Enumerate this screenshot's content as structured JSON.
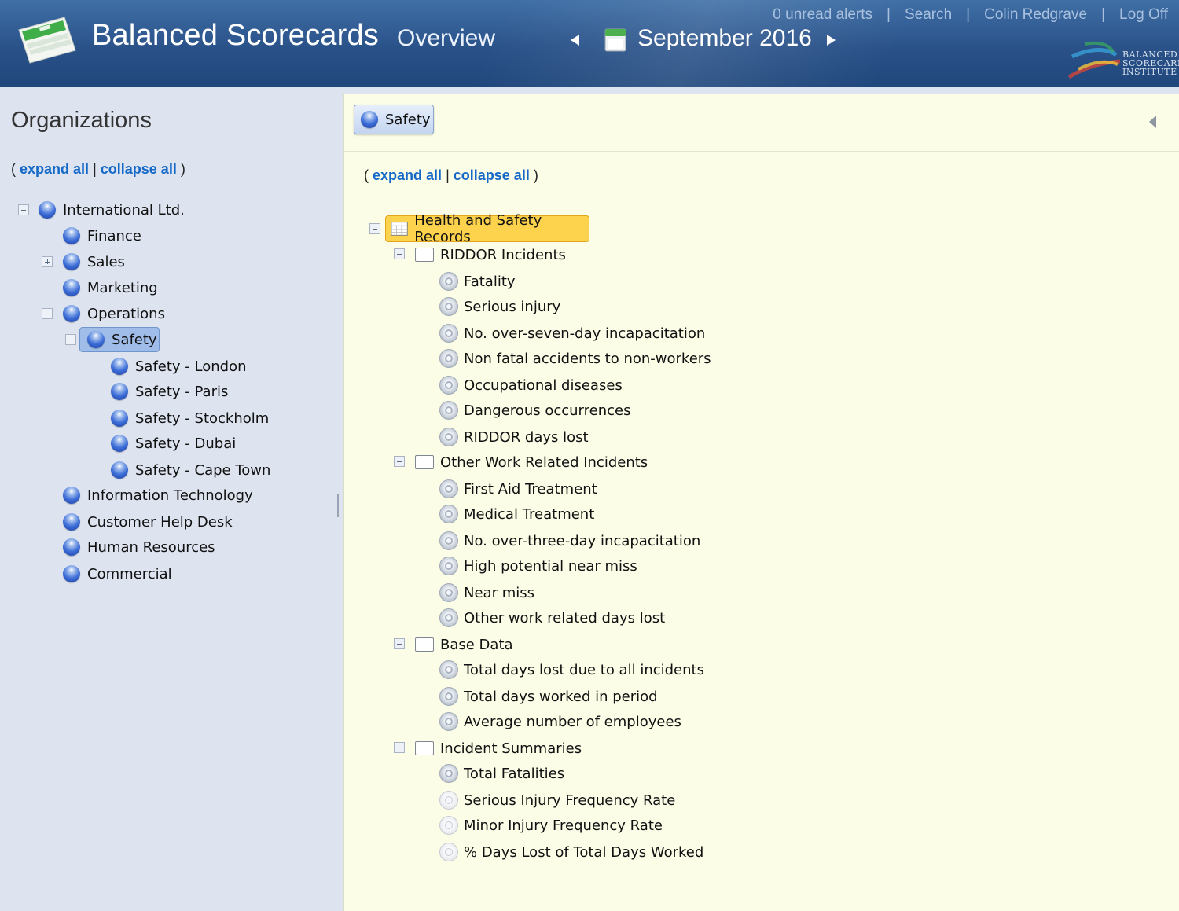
{
  "header": {
    "app_title": "Balanced Scorecards",
    "view_title": "Overview",
    "period": "September 2016",
    "links": {
      "alerts": "0 unread alerts",
      "search": "Search",
      "user": "Colin Redgrave",
      "logoff": "Log Off"
    },
    "separator": "|",
    "institute_lines": [
      "BALANCED",
      "SCORECARD",
      "INSTITUTE"
    ],
    "colors": {
      "header_top": "#3f6fa6",
      "header_bottom": "#1f477c"
    }
  },
  "left_panel": {
    "heading": "Organizations",
    "expand_all": "expand all",
    "collapse_all": "collapse all",
    "paren_open": "(",
    "paren_close": ")",
    "pipe": "|",
    "tree": [
      "International Ltd.",
      "Finance",
      "Sales",
      "Marketing",
      "Operations",
      "Safety",
      "Safety - London",
      "Safety - Paris",
      "Safety - Stockholm",
      "Safety - Dubai",
      "Safety - Cape Town",
      "Information Technology",
      "Customer Help Desk",
      "Human Resources",
      "Commercial"
    ],
    "selected": "Safety"
  },
  "right_panel": {
    "chip_label": "Safety",
    "expand_all": "expand all",
    "collapse_all": "collapse all",
    "paren_open": "(",
    "paren_close": ")",
    "pipe": "|",
    "root": "Health and Safety Records",
    "groups": [
      {
        "title": "RIDDOR Incidents",
        "items": [
          "Fatality",
          "Serious injury",
          "No. over-seven-day incapacitation",
          "Non fatal accidents to non-workers",
          "Occupational diseases",
          "Dangerous occurrences",
          "RIDDOR days lost"
        ]
      },
      {
        "title": "Other Work Related Incidents",
        "items": [
          "First Aid Treatment",
          "Medical Treatment",
          "No. over-three-day incapacitation",
          "High potential near miss",
          "Near miss",
          "Other work related days lost"
        ]
      },
      {
        "title": "Base Data",
        "items": [
          "Total days lost due to all incidents",
          "Total days worked in period",
          "Average number of employees"
        ]
      },
      {
        "title": "Incident Summaries",
        "items": [
          "Total Fatalities",
          "Serious Injury Frequency Rate",
          "Minor Injury Frequency Rate",
          "% Days Lost of Total Days Worked"
        ]
      }
    ],
    "colors": {
      "panel_bg": "#fbfde7",
      "root_highlight": "#fdd34d",
      "link": "#1468c8"
    }
  }
}
